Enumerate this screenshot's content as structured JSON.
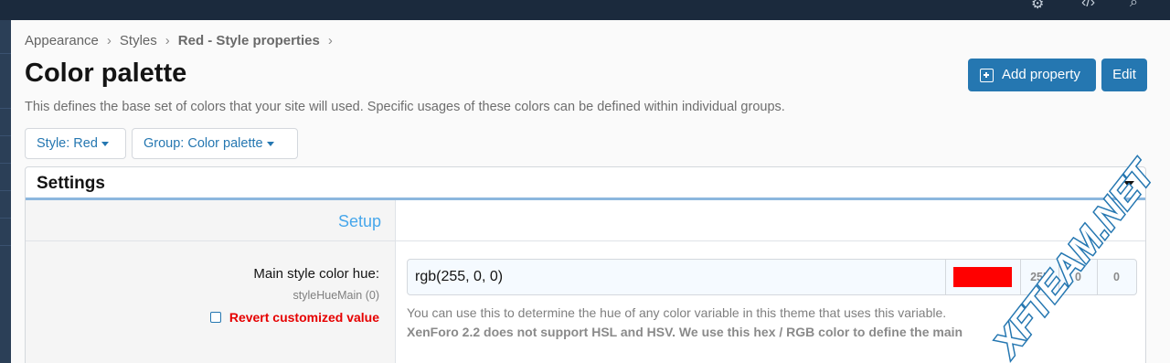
{
  "topbar": {
    "icons": [
      "gear-icon",
      "code-icon",
      "search-icon"
    ]
  },
  "breadcrumb": {
    "items": [
      "Appearance",
      "Styles",
      "Red - Style properties"
    ],
    "separator": "›"
  },
  "page": {
    "title": "Color palette",
    "description": "This defines the base set of colors that your site will used. Specific usages of these colors can be defined within individual groups."
  },
  "actions": {
    "add_property": "Add property",
    "edit": "Edit"
  },
  "filters": {
    "style": "Style: Red",
    "group": "Group: Color palette"
  },
  "block": {
    "title": "Settings",
    "section_heading": "Setup"
  },
  "property": {
    "label": "Main style color hue:",
    "key": "styleHueMain (0)",
    "revert_label": "Revert customized value",
    "value": "rgb(255, 0, 0)",
    "swatch_color": "#ff0000",
    "channels": [
      "255",
      "0",
      "0"
    ],
    "explain": "You can use this to determine the hue of any color variable in this theme that uses this variable.",
    "explain_bold": "XenForo 2.2 does not support HSL and HSV. We use this hex / RGB color to define the main"
  },
  "watermark": {
    "text": "XFTEAM.NET"
  },
  "colors": {
    "accent": "#2577b1",
    "heading_blue": "#47a7eb",
    "revert_red": "#e60000",
    "topbar": "#1b2a3d"
  }
}
